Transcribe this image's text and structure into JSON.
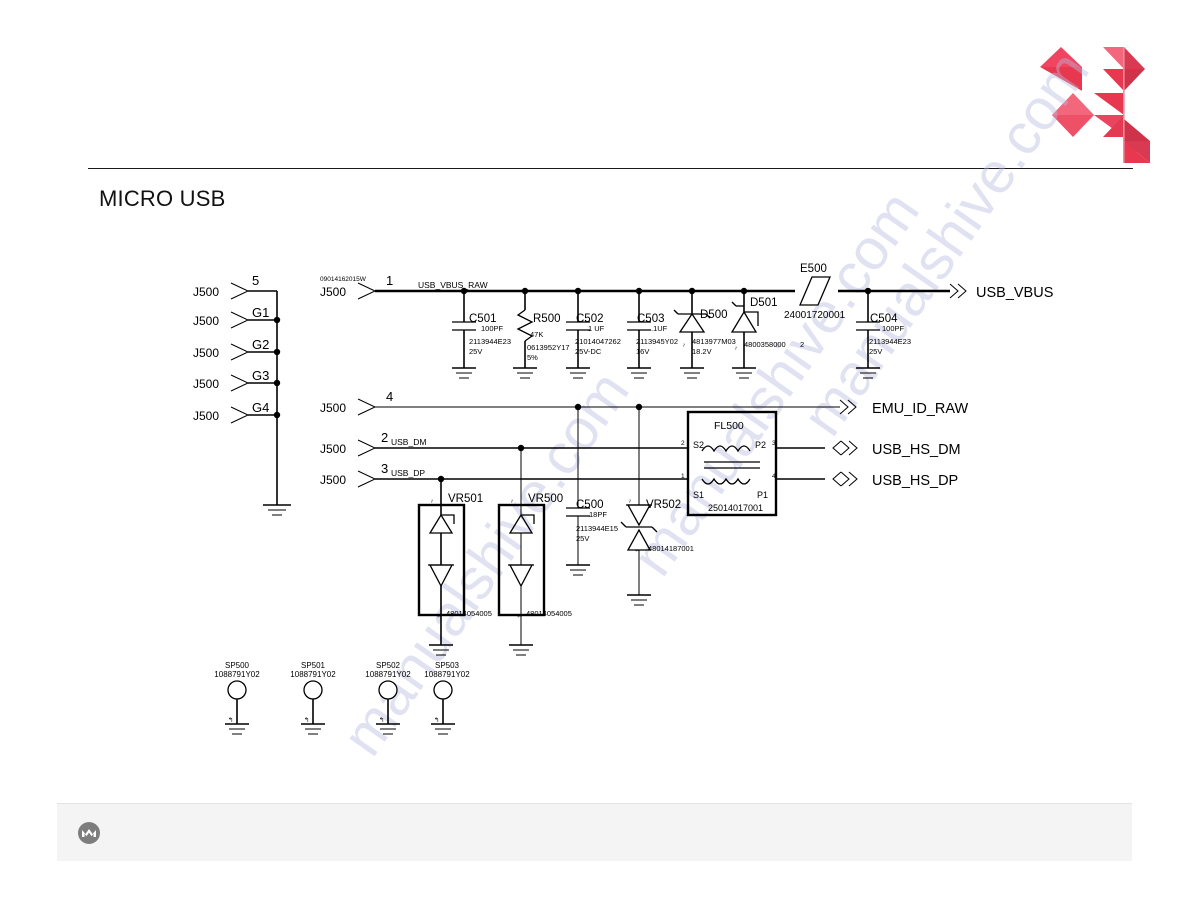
{
  "page": {
    "title": "MICRO USB",
    "brand_color": "#e8384f",
    "brand_logo_name": "red-triangle-logo",
    "footer_logo_name": "motorola-batwing-logo",
    "watermark_text": "manualshive.com"
  },
  "schematic": {
    "connector_ref": "J500",
    "connector_part": "09014162015W",
    "left_pins": [
      {
        "ref": "J500",
        "pin": "5"
      },
      {
        "ref": "J500",
        "pin": "G1"
      },
      {
        "ref": "J500",
        "pin": "G2"
      },
      {
        "ref": "J500",
        "pin": "G3"
      },
      {
        "ref": "J500",
        "pin": "G4"
      }
    ],
    "signal_pins": [
      {
        "ref": "J500",
        "pin": "1",
        "net": "USB_VBUS_RAW"
      },
      {
        "ref": "J500",
        "pin": "4",
        "net": ""
      },
      {
        "ref": "J500",
        "pin": "2",
        "net": "USB_DM"
      },
      {
        "ref": "J500",
        "pin": "3",
        "net": "USB_DP"
      }
    ],
    "output_nets": [
      {
        "label": "USB_VBUS",
        "direction": "out"
      },
      {
        "label": "EMU_ID_RAW",
        "direction": "out"
      },
      {
        "label": "USB_HS_DM",
        "direction": "bidir"
      },
      {
        "label": "USB_HS_DP",
        "direction": "bidir"
      }
    ],
    "components": [
      {
        "ref": "C501",
        "value": "100PF",
        "part": "2113944E23",
        "rating": "25V",
        "type": "capacitor"
      },
      {
        "ref": "R500",
        "value": "47K",
        "part": "0613952Y17",
        "rating": "5%",
        "type": "resistor"
      },
      {
        "ref": "C502",
        "value": "1 UF",
        "part": "21014047262",
        "rating": "25V-DC",
        "type": "capacitor"
      },
      {
        "ref": "C503",
        "value": ".1UF",
        "part": "2113945Y02",
        "rating": "16V",
        "type": "capacitor"
      },
      {
        "ref": "D500",
        "value": "",
        "part": "4813977M03",
        "rating": "18.2V",
        "type": "zener-diode"
      },
      {
        "ref": "D501",
        "value": "",
        "part": "4800358000",
        "rating": "2",
        "type": "diode"
      },
      {
        "ref": "E500",
        "value": "",
        "part": "24001720001",
        "rating": "",
        "type": "ferrite-bead"
      },
      {
        "ref": "C504",
        "value": "100PF",
        "part": "2113944E23",
        "rating": "25V",
        "type": "capacitor"
      },
      {
        "ref": "C500",
        "value": "18PF",
        "part": "2113944E15",
        "rating": "25V",
        "type": "capacitor"
      },
      {
        "ref": "VR501",
        "value": "",
        "part": "48014054005",
        "rating": "",
        "type": "tvs-array"
      },
      {
        "ref": "VR500",
        "value": "",
        "part": "48014054005",
        "rating": "",
        "type": "tvs-array"
      },
      {
        "ref": "VR502",
        "value": "",
        "part": "48014187001",
        "rating": "",
        "type": "tvs-diode"
      }
    ],
    "filter": {
      "ref": "FL500",
      "part": "25014017001",
      "pins": {
        "in_top": "2",
        "out_top": "3",
        "in_bottom": "1",
        "out_bottom": "4"
      },
      "labels": {
        "s2": "S2",
        "p2": "P2",
        "s1": "S1",
        "p1": "P1"
      }
    },
    "test_points": [
      {
        "ref": "SP500",
        "part": "1088791Y02"
      },
      {
        "ref": "SP501",
        "part": "1088791Y02"
      },
      {
        "ref": "SP502",
        "part": "1088791Y02"
      },
      {
        "ref": "SP503",
        "part": "1088791Y02"
      }
    ]
  }
}
